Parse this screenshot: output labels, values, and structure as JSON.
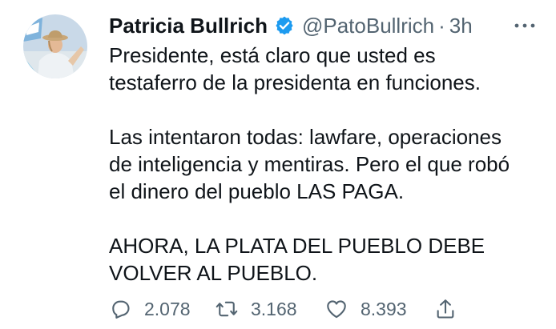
{
  "tweet": {
    "author_name": "Patricia Bullrich",
    "handle": "@PatoBullrich",
    "separator": "·",
    "time": "3h",
    "paragraphs": [
      "Presidente, está claro que usted es\ntestaferro de la presidenta en funciones.",
      "Las intentaron todas: lawfare, operaciones\nde inteligencia y mentiras. Pero el que robó\nel dinero del pueblo LAS PAGA.",
      "AHORA, LA PLATA DEL PUEBLO DEBE\nVOLVER AL PUEBLO."
    ]
  },
  "actions": {
    "reply_count": "2.078",
    "retweet_count": "3.168",
    "like_count": "8.393"
  },
  "icons": {
    "verified": "verified-badge-icon",
    "more": "more-options-icon",
    "reply": "reply-icon",
    "retweet": "retweet-icon",
    "like": "heart-icon",
    "share": "share-icon"
  },
  "colors": {
    "text": "#0f1419",
    "secondary": "#536471",
    "verified": "#1d9bf0"
  }
}
